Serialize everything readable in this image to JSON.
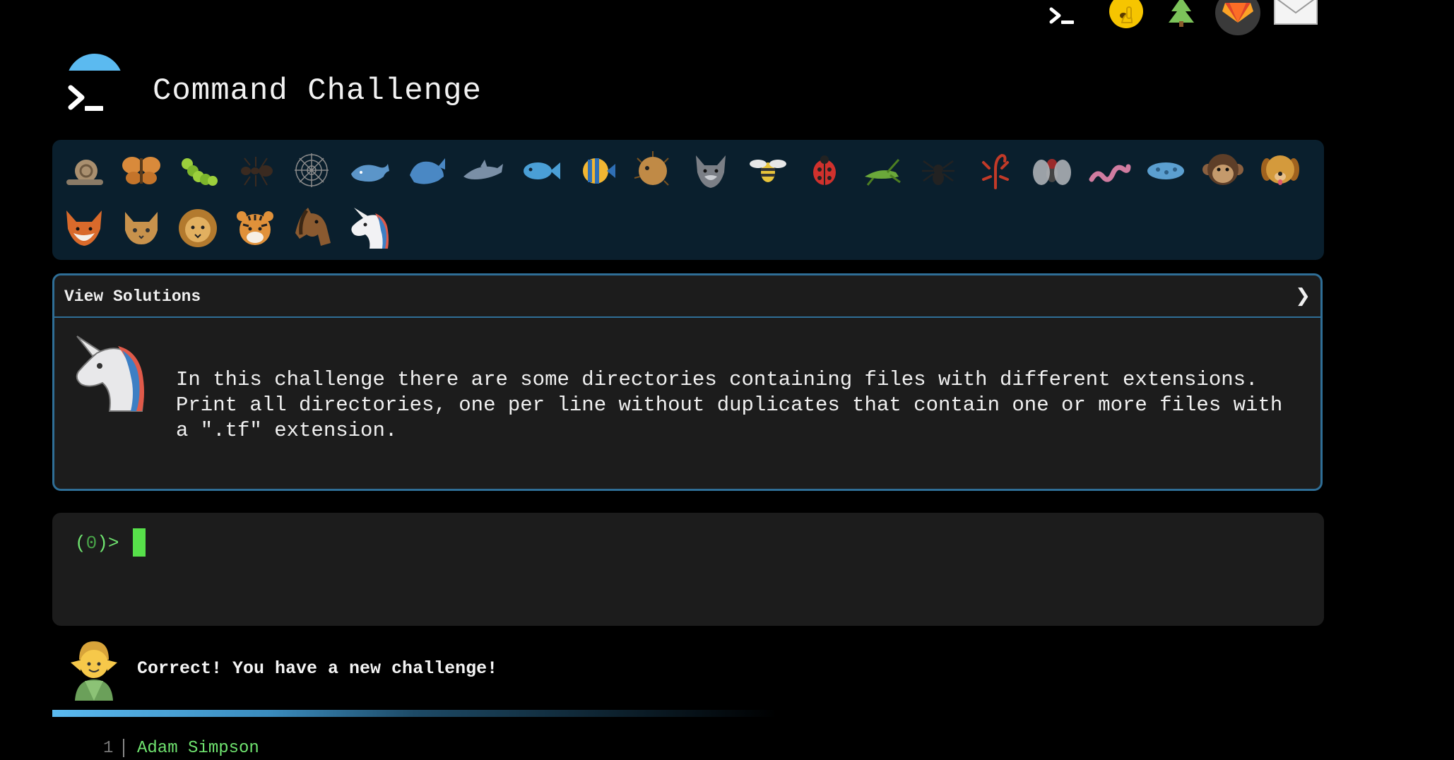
{
  "nav": {
    "icons": [
      "terminal-icon",
      "shushing-face-icon",
      "tree-icon",
      "gitlab-icon",
      "mail-icon"
    ]
  },
  "header": {
    "title": "Command Challenge",
    "logo": "terminal-logo-icon"
  },
  "animals": [
    "snail",
    "butterfly",
    "caterpillar",
    "ant",
    "spider-web",
    "whale",
    "whale-2",
    "dolphin",
    "fish",
    "tropical-fish",
    "blowfish",
    "wolf",
    "bee",
    "ladybug",
    "cricket",
    "spider",
    "scorpion",
    "fly",
    "worm",
    "microbe",
    "monkey",
    "dog",
    "fox",
    "cat",
    "lion",
    "tiger",
    "horse",
    "unicorn"
  ],
  "solutions": {
    "label": "View Solutions",
    "chevron": "❯"
  },
  "challenge": {
    "description": "In this challenge there are some directories containing files with different extensions. Print all directories, one per line without duplicates that contain one or more files with a \".tf\" extension."
  },
  "terminal": {
    "prompt_open": "(",
    "prompt_num": "0",
    "prompt_close": ")>"
  },
  "result": {
    "message": "Correct! You have a new challenge!",
    "progress": 0.57
  },
  "output": {
    "line_number": "1",
    "value": "Adam Simpson"
  },
  "colors": {
    "accent": "#5bbaf0",
    "card_border": "#2f6e96",
    "prompt_green": "#6fe36f",
    "strip_bg": "#0a1f2d"
  }
}
